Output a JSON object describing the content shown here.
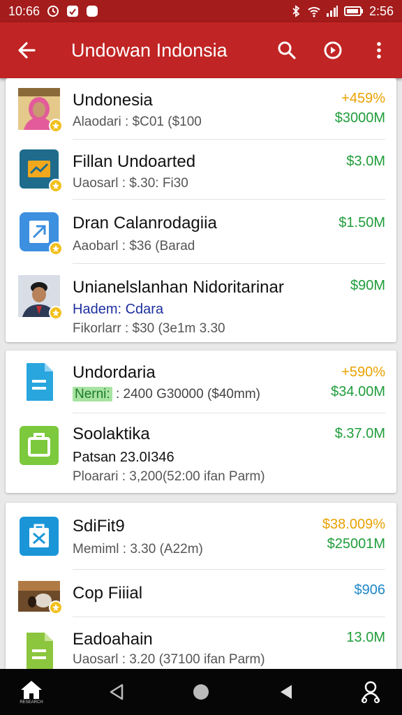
{
  "status_bar": {
    "time_left": "10:66",
    "time_right": "2:56"
  },
  "app_bar": {
    "title": "Undowan Indonsia"
  },
  "card1": {
    "rows": [
      {
        "title": "Undonesia",
        "subtitle": "Alaodari : $C01 ($100",
        "value_top": "+459%",
        "value": "$3000M",
        "top_color": "#e8a200",
        "color": "#1f9d3a"
      },
      {
        "title": "Fillan Undoarted",
        "subtitle": "Uaosarl : $.30: Fi30",
        "value": "$3.0M",
        "color": "#1f9d3a"
      },
      {
        "title": "Dran Calanrodagiia",
        "subtitle": "Aaobarl : $36 (Barad",
        "value": "$1.50M",
        "color": "#1f9d3a"
      },
      {
        "title": "Unianelslanhan Nidoritarinar",
        "subtitle_link_label": "Hadem:",
        "subtitle_link": "Cdara",
        "subtitle": "Fikorlarr : $30 (3e1m 3.30",
        "value": "$90M",
        "color": "#1f9d3a"
      }
    ]
  },
  "card2": {
    "rows": [
      {
        "title": "Undordaria",
        "tag": "Nerni:",
        "subtitle": ": 2400 G30000 ($40mm)",
        "value_top": "+590%",
        "value": "$34.00M",
        "top_color": "#e8a200",
        "color": "#1f9d3a"
      },
      {
        "title": "Soolaktika",
        "line2": "Patsan 23.0I346",
        "subtitle": "Ploarari : 3,200(52:00 ifan Parm)",
        "value": "$.37.0M",
        "color": "#1f9d3a"
      }
    ]
  },
  "card3": {
    "rows": [
      {
        "title": "SdiFit9",
        "subtitle": "Memiml : 3.30 (A22m)",
        "value_top": "$38.009%",
        "value": "$25001M",
        "top_color": "#e8a200",
        "color": "#1f9d3a"
      },
      {
        "title": "Cop Fiiial",
        "value": "$906",
        "color": "#1e88c8"
      },
      {
        "title": "Eadoahain",
        "subtitle": "Uaosarl : 3.20 (37100 ifan Parm)",
        "value": "13.0M",
        "color": "#1f9d3a"
      }
    ]
  },
  "nav": {
    "home_label": "RESEARCH"
  }
}
